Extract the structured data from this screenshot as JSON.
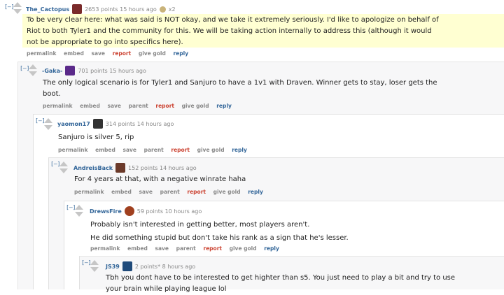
{
  "comments": [
    {
      "collapse": "[–]",
      "author": "The_Cactopus",
      "meta": "2653 points 15 hours ago",
      "extra": "x2",
      "body": [
        "To be very clear here: what was said is NOT okay, and we take it extremely seriously. I'd like to apologize on behalf of",
        "Riot to both Tyler1 and the community for this. We will be taking action internally to address this (although it would",
        "not be appropriate to go into specifics here)."
      ],
      "buttons": [
        "permalink",
        "embed",
        "save",
        "report",
        "give gold",
        "reply"
      ]
    },
    {
      "collapse": "[–]",
      "author": "-Gaka-",
      "meta": "701 points 15 hours ago",
      "body": [
        "The only logical scenario is for Tyler1 and Sanjuro to have a 1v1 with Draven. Winner gets to stay, loser gets the",
        "boot."
      ],
      "buttons": [
        "permalink",
        "embed",
        "save",
        "parent",
        "report",
        "give gold",
        "reply"
      ]
    },
    {
      "collapse": "[–]",
      "author": "yaomon17",
      "meta": "314 points 14 hours ago",
      "body": [
        "Sanjuro is silver 5, rip"
      ],
      "buttons": [
        "permalink",
        "embed",
        "save",
        "parent",
        "report",
        "give gold",
        "reply"
      ]
    },
    {
      "collapse": "[–]",
      "author": "AndreisBack",
      "meta": "152 points 14 hours ago",
      "body": [
        "For 4 years at that, with a negative winrate haha"
      ],
      "buttons": [
        "permalink",
        "embed",
        "save",
        "parent",
        "report",
        "give gold",
        "reply"
      ]
    },
    {
      "collapse": "[–]",
      "author": "DrewsFire",
      "meta": "59 points 10 hours ago",
      "body": [
        "Probably isn't interested in getting better, most players aren't.",
        "He did something stupid but don't take his rank as a sign that he's lesser."
      ],
      "buttons": [
        "permalink",
        "embed",
        "save",
        "parent",
        "report",
        "give gold",
        "reply"
      ]
    },
    {
      "collapse": "[–]",
      "author": "JS39",
      "meta": "2 points* 8 hours ago",
      "body": [
        "Tbh you dont have to be interested to get highter than s5. You just need to play a bit and try to use",
        "your brain while playing league lol"
      ],
      "buttons": []
    }
  ],
  "colors": {
    "author": "#336699",
    "report": "#cc4433",
    "highlight": "#ffffd2"
  }
}
